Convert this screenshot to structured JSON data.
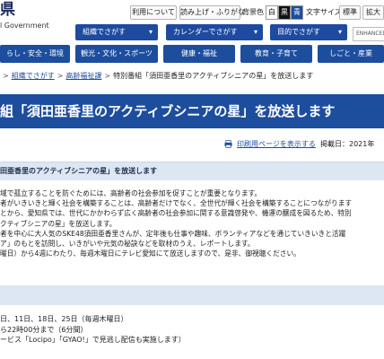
{
  "header": {
    "logo_main": "県",
    "logo_sub": "l Government",
    "utility_links": [
      "利用について",
      "読み上げ・ふりがな"
    ],
    "bg_color_label": "背景色",
    "bg_swatches": [
      {
        "label": "白",
        "bg": "#ffffff",
        "fg": "#000000"
      },
      {
        "label": "黒",
        "bg": "#111111",
        "fg": "#ffffff"
      },
      {
        "label": "青",
        "bg": "#1d4e9e",
        "fg": "#ffffff"
      }
    ],
    "text_size_label": "文字サイズ",
    "text_size_buttons": [
      "標準",
      "拡大"
    ],
    "dropdowns": [
      {
        "label": "組織でさがす",
        "icon": "chevron-down-icon"
      },
      {
        "label": "カレンダーでさがす",
        "icon": "chevron-down-icon"
      },
      {
        "label": "目的でさがす",
        "icon": "chevron-down-icon"
      }
    ],
    "search_placeholder": "ENHANCED BY G"
  },
  "nav": {
    "items": [
      "らし・安全・環境",
      "観光・文化・スポーツ",
      "健康・福祉",
      "教育・子育て",
      "しごと・産業"
    ]
  },
  "breadcrumb": {
    "items": [
      "組織でさがす",
      "高齢福祉課"
    ],
    "current": "特別番組「須田亜香里のアクティブシニアの星」を放送します"
  },
  "page": {
    "title": "組「須田亜香里のアクティブシニアの星」を放送します",
    "print_label": "印刷用ページを表示する",
    "post_date": "掲載日：2021年",
    "lead": "田亜香里のアクティブシニアの星」を放送します",
    "body_lines": [
      "域で孤立することを防ぐためには、高齢者の社会参加を促すことが重要となります。",
      "者がいきいきと輝く社会を構築することは、高齢者だけでなく、全世代が輝く社会を構築することにつながります",
      "とから、愛知県では、世代にかかわらず広く高齢者の社会参加に関する意識啓発や、機運の醸成を図るため、特別",
      "クティブシニアの星」を放送します。",
      "者を中心に大人気のSKE48須田亜香里さんが、定年後も仕事や趣味、ボランティアなどを通じていきいきと活躍",
      "ア」のもとを訪問し、いきがいや元気の秘訣などを取材のうえ、レポートします。",
      "曜日）から4週にわたり、毎週木曜日にテレビ愛知にて放送しますので、是非、御視聴ください。"
    ],
    "schedule_lines": [
      "日、11日、18日、25日（毎週木曜日）",
      "ら22時00分まで（6分間）",
      "ービス「Locipo」「GYAO!」で見逃し配信も実施します）"
    ]
  },
  "colors": {
    "brand_blue": "#1d4e9e",
    "light_blue": "#dde7f4",
    "link_blue": "#1d4e9e"
  }
}
